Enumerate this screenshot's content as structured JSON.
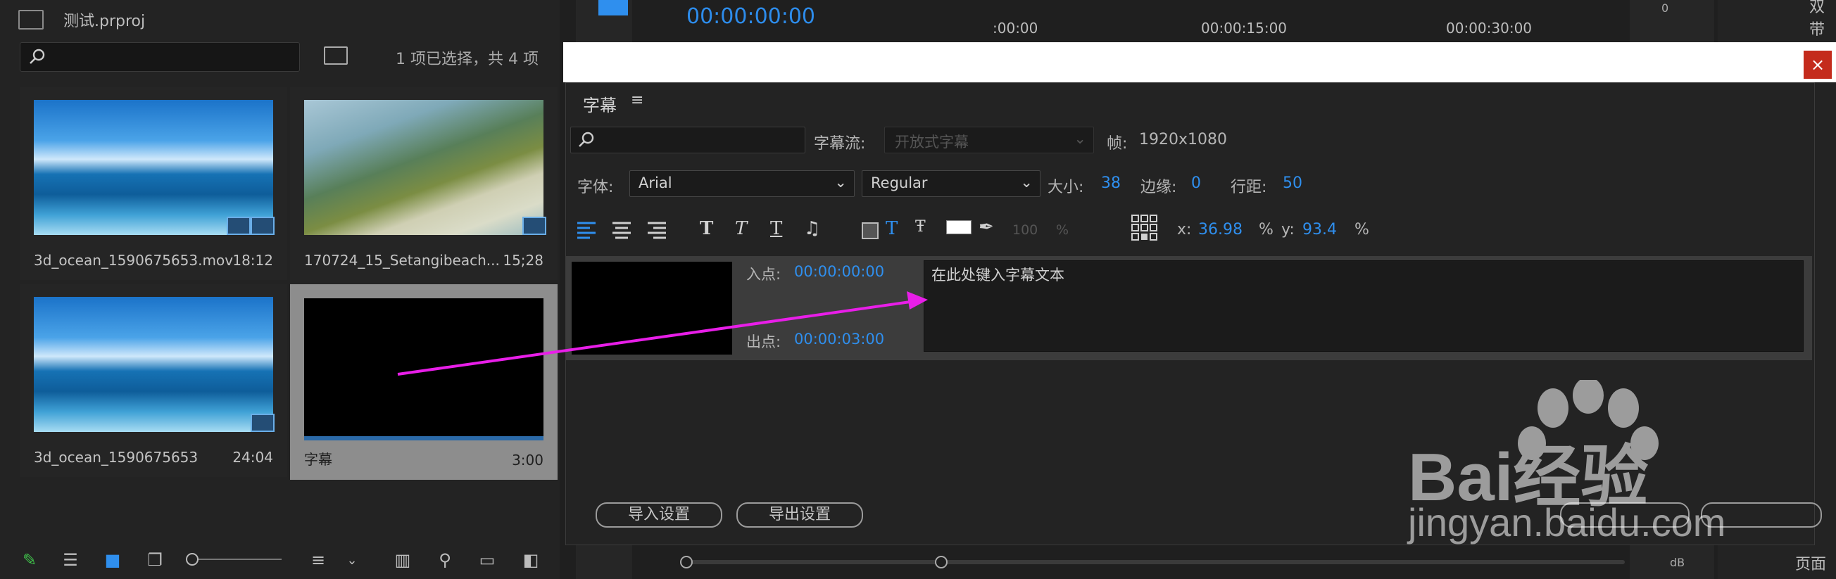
{
  "project": {
    "file_name": "测试.prproj",
    "search_placeholder": "",
    "selection_status": "1 项已选择，共 4 项",
    "items": [
      {
        "name": "3d_ocean_1590675653.mov",
        "duration": "18:12"
      },
      {
        "name": "170724_15_Setangibeach...",
        "duration": "15;28"
      },
      {
        "name": "3d_ocean_1590675653",
        "duration": "24:04"
      },
      {
        "name": "字幕",
        "duration": "3:00"
      }
    ]
  },
  "program": {
    "timecode": "00:00:00:00",
    "ruler": [
      ":00:00",
      "00:00:15:00",
      "00:00:30:00"
    ],
    "meter_top": "0",
    "meter_bottom": "dB"
  },
  "right_panel": {
    "item1": "双",
    "item2": "带着",
    "item3": "页面"
  },
  "dialog": {
    "title": "字幕",
    "menu_icon": "≡",
    "close": "×",
    "search_placeholder": "",
    "stream_label": "字幕流:",
    "stream_value": "开放式字幕",
    "frame_label": "帧:",
    "frame_value": "1920x1080",
    "font_label": "字体:",
    "font_value": "Arial",
    "style_value": "Regular",
    "size_label": "大小:",
    "size_value": "38",
    "edge_label": "边缘:",
    "edge_value": "0",
    "line_label": "行距:",
    "line_value": "50",
    "opacity_value": "100",
    "opacity_unit": "%",
    "x_label": "x:",
    "x_value": "36.98",
    "x_unit": "%",
    "y_label": "y:",
    "y_value": "93.4",
    "y_unit": "%",
    "in_label": "入点:",
    "in_value": "00:00:00:00",
    "out_label": "出点:",
    "out_value": "00:00:03:00",
    "caption_text": "在此处键入字幕文本",
    "import_btn": "导入设置",
    "export_btn": "导出设置"
  },
  "watermark": {
    "brand": "Bai经验",
    "url": "jingyan.baidu.com"
  },
  "colors": {
    "accent_blue": "#2f8fee",
    "arrow_magenta": "#e81ee8",
    "close_red": "#c42b1c"
  }
}
